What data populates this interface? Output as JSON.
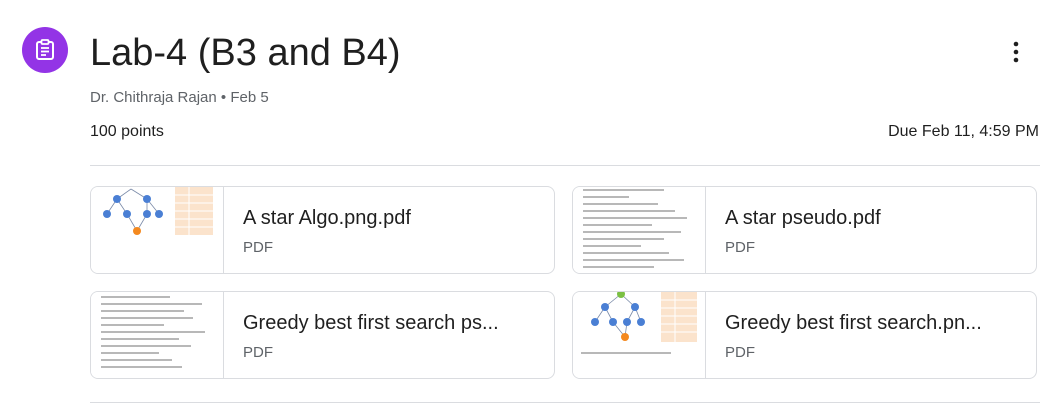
{
  "header": {
    "title": "Lab-4 (B3 and B4)",
    "author": "Dr. Chithraja Rajan",
    "date": "Feb 5",
    "separator": "•",
    "points": "100 points",
    "due": "Due Feb 11, 4:59 PM"
  },
  "icons": {
    "assignment": "assignment-icon",
    "more": "more-vert-icon"
  },
  "attachments": [
    {
      "name": "A star Algo.png.pdf",
      "type": "PDF"
    },
    {
      "name": "A star pseudo.pdf",
      "type": "PDF"
    },
    {
      "name": "Greedy best first search ps...",
      "type": "PDF"
    },
    {
      "name": "Greedy best first search.pn...",
      "type": "PDF"
    }
  ],
  "colors": {
    "accent": "#9334e6",
    "node_blue": "#4a7fd4",
    "node_orange": "#f4891f",
    "table_peach": "#fbe3cc"
  }
}
